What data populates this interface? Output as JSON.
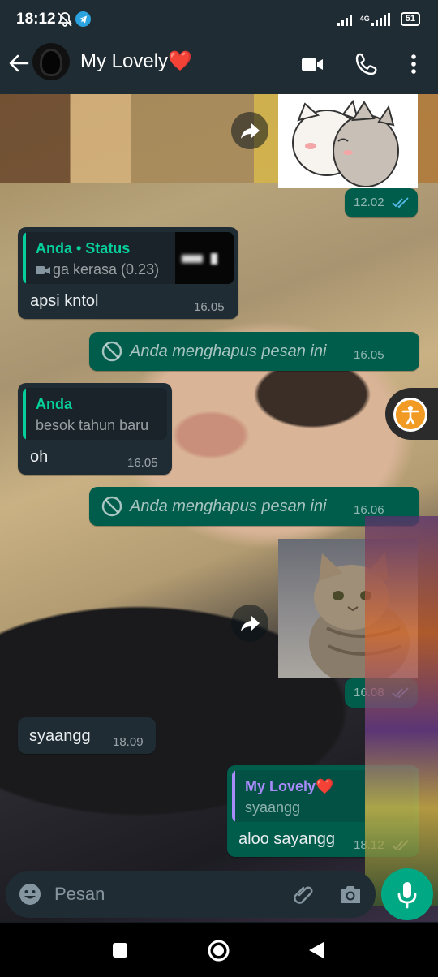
{
  "status_bar": {
    "time": "18:12",
    "network": "4G",
    "battery": "51"
  },
  "header": {
    "contact_name": "My Lovely❤️"
  },
  "messages": [
    {
      "type": "sticker",
      "direction": "out",
      "time": "12.02"
    },
    {
      "type": "reply",
      "direction": "in",
      "quote_author": "Anda • Status",
      "quote_text": "ga kerasa (0.23)",
      "text": "apsi kntol",
      "time": "16.05"
    },
    {
      "type": "deleted",
      "direction": "out",
      "text": "Anda menghapus pesan ini",
      "time": "16.05"
    },
    {
      "type": "reply",
      "direction": "in",
      "quote_author": "Anda",
      "quote_text": "besok tahun baru",
      "text": "oh",
      "time": "16.05"
    },
    {
      "type": "deleted",
      "direction": "out",
      "text": "Anda menghapus pesan ini",
      "time": "16.06"
    },
    {
      "type": "sticker",
      "direction": "out",
      "time": "16.08"
    },
    {
      "type": "text",
      "direction": "in",
      "text": "syaangg",
      "time": "18.09"
    },
    {
      "type": "reply",
      "direction": "out",
      "quote_author": "My Lovely❤️",
      "quote_text": "syaangg",
      "text": "aloo sayangg",
      "time": "18.12"
    }
  ],
  "input": {
    "placeholder": "Pesan"
  },
  "colors": {
    "header_bg": "#1f2c34",
    "incoming_bubble": "#1f2c34",
    "outgoing_bubble": "#005c4b",
    "accent": "#00a884",
    "quote_author_self": "#06cf9c",
    "quote_author_contact": "#a78bfa",
    "read_ticks": "#53bdeb"
  }
}
